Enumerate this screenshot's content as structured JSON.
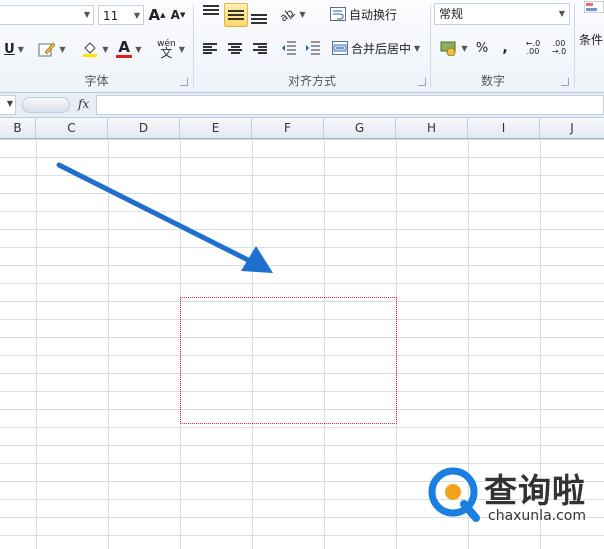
{
  "ribbon": {
    "font_group": {
      "font_size": "11",
      "label": "字体",
      "grow_label": "A",
      "shrink_label": "A",
      "underline_label": "U",
      "font_color_label": "A",
      "phonetic_label": "wén"
    },
    "alignment_group": {
      "label": "对齐方式",
      "wrap_text": "自动换行",
      "merge_center": "合并后居中"
    },
    "number_group": {
      "label": "数字",
      "format": "常规",
      "percent": "%",
      "comma": ",",
      "inc_decimal": "←.0\n.00",
      "dec_decimal": ".00\n→.0"
    },
    "styles_group": {
      "conditional_partial": "条件"
    }
  },
  "formula_bar": {
    "fx": "fx"
  },
  "columns": [
    "B",
    "C",
    "D",
    "E",
    "F",
    "G",
    "H",
    "I",
    "J"
  ],
  "watermark": {
    "title": "查询啦",
    "url": "chaxunla.com"
  },
  "colors": {
    "arrow": "#1f6fd1",
    "selection_border": "#d9262a",
    "watermark_blue": "#1a7fe0",
    "watermark_orange": "#f4a21a"
  }
}
